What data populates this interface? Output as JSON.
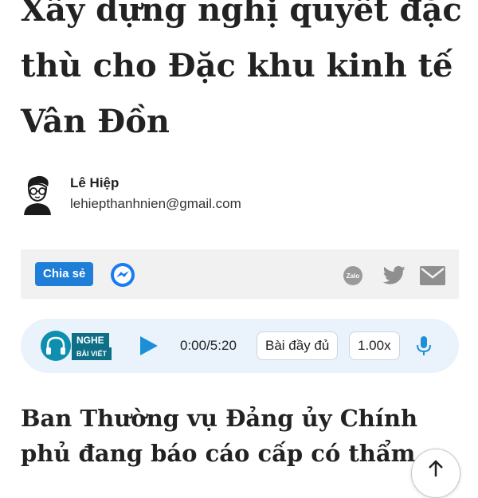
{
  "article": {
    "title": "Xây dựng nghị quyết đặc thù cho Đặc khu kinh tế Vân Đồn",
    "lead": "Ban Thường vụ Đảng ủy Chính phủ đang báo cáo cấp có thẩm"
  },
  "author": {
    "name": "Lê Hiệp",
    "email": "lehiepthanhnien@gmail.com"
  },
  "share": {
    "share_label": "Chia sẻ",
    "zalo_label": "Zalo",
    "icons": [
      "messenger-icon",
      "zalo-icon",
      "twitter-icon",
      "mail-icon"
    ]
  },
  "audio": {
    "badge_top": "NGHE",
    "badge_bottom": "BÀI VIẾT",
    "time": "0:00/5:20",
    "mode_label": "Bài đầy đủ",
    "speed_label": "1.00x"
  },
  "colors": {
    "share_button": "#1e7ed8",
    "messenger": "#1a7cf0",
    "audio_bar": "#eaf3fb",
    "accent_teal": "#0e6f87",
    "play": "#1d8fd8"
  }
}
